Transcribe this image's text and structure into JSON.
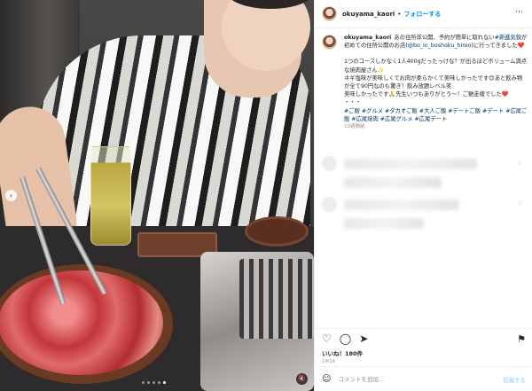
{
  "post": {
    "username": "okuyama_kaori",
    "follow_label": "フォローする",
    "more_icon": "⋯"
  },
  "caption": {
    "username": "okuyama_kaori",
    "line1_pre": "あの住所非公開、予約が簡単に取れない",
    "line1_hashtags": "#新進気鋭",
    "line1_mid": "が初めての住所公開のお店",
    "line1_link": "(@bo_in_boshoku_hiroo)",
    "line1_post": "に行ってきました❤️",
    "para2": "1つのコースしかなく1人400gだったっけな？が出るほどボリューム満点な焼肉屋さん✨",
    "para3": "ネギ塩味が美味しくてお肉が柔らかくて美味しかったです😊あと飲み物が全て90円なのも驚き！飲み放題レベル笑",
    "para4": "美味しかったです🙏先生いつもありがとう〜！ご馳走様でした❤️",
    "dots": "・・・",
    "hashtags": "#ご飯 #グルメ #タカオご飯 #大人ご飯 #デートご飯 #デート #広尾ご飯 #広尾焼肉 #広尾グルメ #広尾デート",
    "time": "10週間前"
  },
  "actions": {
    "like_icon": "heart-icon",
    "comment_icon": "comment-icon",
    "share_icon": "share-icon",
    "save_icon": "bookmark-icon"
  },
  "likes": "いいね！180件",
  "date": "2月14",
  "comment_box": {
    "placeholder": "コメントを追加...",
    "post_label": "投稿する"
  },
  "media": {
    "mute_icon": "🔇"
  }
}
